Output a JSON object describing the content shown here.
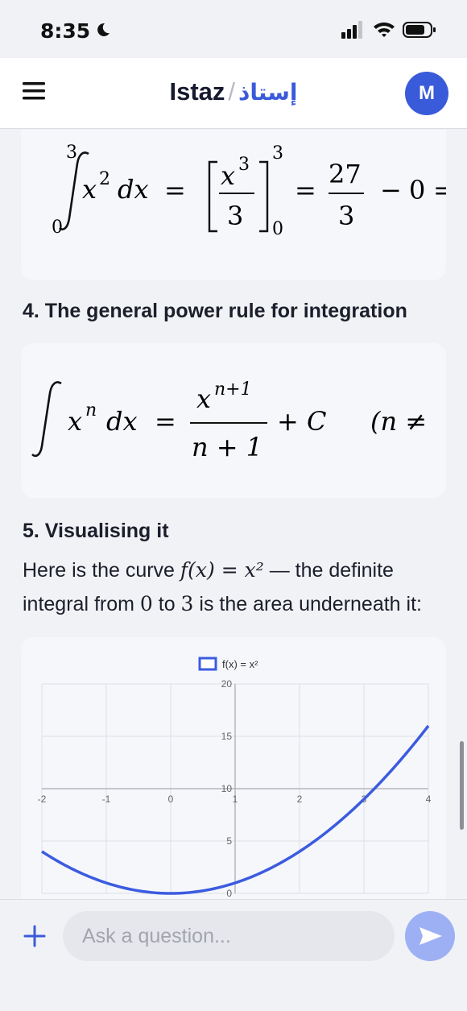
{
  "status": {
    "time": "8:35",
    "icons": [
      "moon-icon",
      "cellular-signal-icon",
      "wifi-icon",
      "battery-icon"
    ]
  },
  "header": {
    "brand": "Istaz",
    "separator": "/",
    "brand_arabic": "إستاذ",
    "avatar_initial": "M",
    "accent": "#3a5bd9"
  },
  "sections": {
    "s4_title": "4. The general power rule for integration",
    "s5_title": "5. Visualising it",
    "para_pre": "Here is the curve ",
    "para_fx": "f(x) = x²",
    "para_mid": " — the definite integral from ",
    "para_lo": "0",
    "para_to": " to ",
    "para_hi": "3",
    "para_end": " is the area underneath it:"
  },
  "formula1": {
    "upper": "3",
    "lower": "0",
    "integrand": "x",
    "integrand_exp": "2",
    "dx": "dx",
    "eq": "=",
    "frac_num": "x",
    "frac_num_exp": "3",
    "frac_den": "3",
    "bracket_upper": "3",
    "bracket_lower": "0",
    "eq2": "=",
    "result_num": "27",
    "result_den": "3",
    "minus": "−",
    "zero": "0",
    "eq3": "="
  },
  "formula2": {
    "integrand": "x",
    "integrand_exp": "n",
    "dx": "dx",
    "eq": "=",
    "num": "x",
    "num_exp": "n+1",
    "den": "n + 1",
    "plus_c": "+ C",
    "cond": "(n ≠"
  },
  "chart_data": {
    "type": "line",
    "legend": "f(x) = x²",
    "legend_position": "top-center",
    "x_ticks": [
      "-2",
      "-1",
      "0",
      "1",
      "2",
      "3",
      "4"
    ],
    "y_ticks": [
      "0",
      "5",
      "10",
      "15",
      "20"
    ],
    "xlim": [
      -2,
      4
    ],
    "ylim": [
      0,
      20
    ],
    "grid": true,
    "series": [
      {
        "name": "f(x) = x²",
        "color": "#3b5be0",
        "x": [
          -2,
          -1.5,
          -1,
          -0.5,
          0,
          0.5,
          1,
          1.5,
          2,
          2.5,
          3,
          3.5,
          4
        ],
        "y": [
          4,
          2.25,
          1,
          0.25,
          0,
          0.25,
          1,
          2.25,
          4,
          6.25,
          9,
          12.25,
          16
        ]
      }
    ]
  },
  "input": {
    "placeholder": "Ask a question...",
    "value": ""
  }
}
